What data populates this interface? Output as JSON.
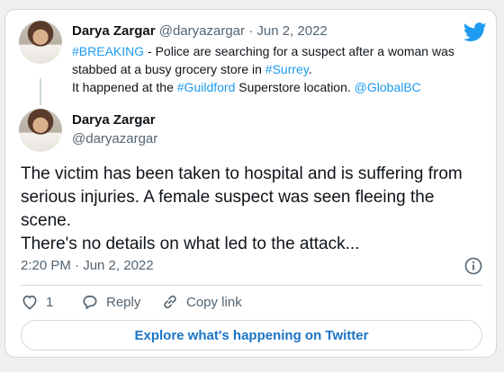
{
  "quoted": {
    "author_name": "Darya Zargar",
    "author_handle": "@daryazargar",
    "separator": "·",
    "date": "Jun 2, 2022",
    "line1_hashtag": "#BREAKING",
    "line1_text": " - Police are searching for a suspect after a woman was stabbed at a busy grocery store in ",
    "line1_hashtag2": "#Surrey",
    "line1_end": ".",
    "line2_text": "It happened at the ",
    "line2_hashtag": "#Guildford",
    "line2_text2": " Superstore location.  ",
    "line2_mention": "@GlobalBC"
  },
  "main": {
    "author_name": "Darya Zargar",
    "author_handle": "@daryazargar",
    "text_line1": "The victim has been taken to hospital and is suffering from serious injuries. A female suspect was seen fleeing the scene.",
    "text_line2": "There's no details on what led to the attack...",
    "timestamp": "2:20 PM · Jun 2, 2022"
  },
  "actions": {
    "like_count": "1",
    "reply_label": "Reply",
    "copy_link_label": "Copy link"
  },
  "explore_label": "Explore what's happening on Twitter",
  "colors": {
    "link": "#1d9bf0",
    "muted": "#536471",
    "border": "#cfd9de"
  },
  "icons": [
    "twitter-icon",
    "info-icon",
    "heart-icon",
    "reply-icon",
    "link-icon"
  ]
}
